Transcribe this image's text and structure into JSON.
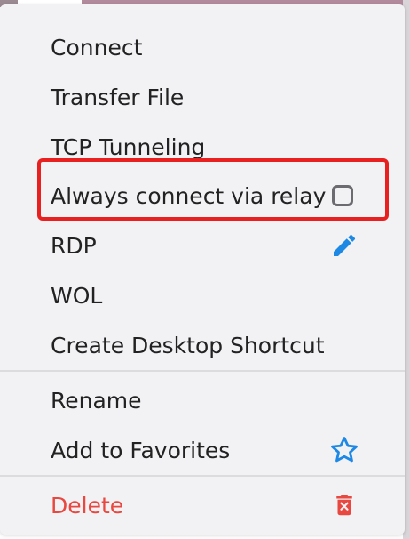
{
  "menu": {
    "items": [
      {
        "label": "Connect"
      },
      {
        "label": "Transfer File"
      },
      {
        "label": "TCP Tunneling"
      },
      {
        "label": "Always connect via relay",
        "checked": false
      },
      {
        "label": "RDP",
        "icon": "pencil-icon"
      },
      {
        "label": "WOL"
      },
      {
        "label": "Create Desktop Shortcut"
      },
      {
        "label": "Rename"
      },
      {
        "label": "Add to Favorites",
        "icon": "star-outline-icon"
      },
      {
        "label": "Delete",
        "icon": "trash-icon"
      }
    ]
  },
  "colors": {
    "menu_background": "#f2f1f4",
    "text": "#222222",
    "accent_blue": "#1e88e5",
    "delete_red": "#e8483f",
    "highlight_red": "#e8201f"
  }
}
